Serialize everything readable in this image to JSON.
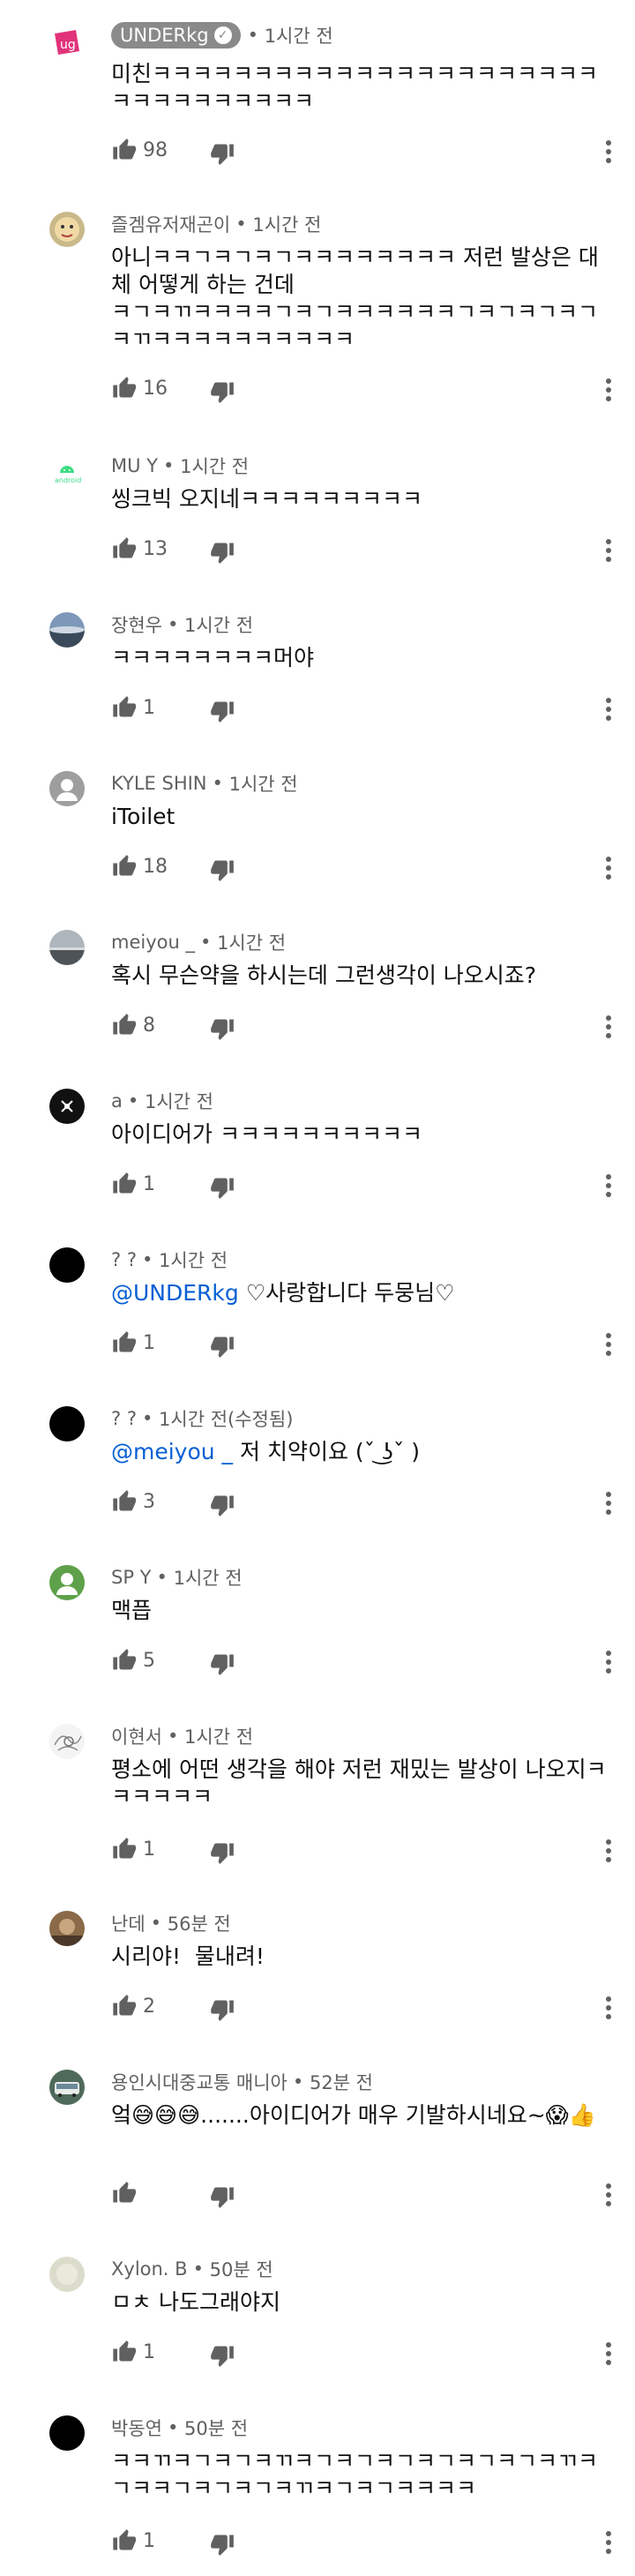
{
  "comments": [
    {
      "author": "UNDERkg",
      "time": "1시간 전",
      "text": "미친ㅋㅋㅋㅋㅋㅋㅋㅋㅋㅋㅋㅋㅋㅋㅋㅋㅋㅋㅋㅋㅋㅋㅋㅋㅋㅋㅋㅋㅋㅋㅋㅋ",
      "likes": "98",
      "is_creator": true,
      "avatar": "ug-logo"
    },
    {
      "author": "즐겜유저재곤이",
      "time": "1시간 전",
      "text": "아니ㅋㅋㄱㅋㄱㅋㄱㅋㅋㅋㅋㅋㅋㅋㅋ 저런 발상은 대체 어떻게 하는 건데\nㅋㄱㅋㄲㅋㅋㅋㅋㄱㅋㄱㅋㅋㅋㅋㅋㅋㄱㅋㄱㅋㄱㅋㄱㅋㄲㅋㅋㅋㅋㅋㅋㅋㅋㅋㅋ",
      "likes": "16",
      "avatar": "cartoon"
    },
    {
      "author": "MU Y",
      "time": "1시간 전",
      "text": "씽크빅 오지네ㅋㅋㅋㅋㅋㅋㅋㅋㅋ",
      "likes": "13",
      "avatar": "android"
    },
    {
      "author": "장현우",
      "time": "1시간 전",
      "text": "ㅋㅋㅋㅋㅋㅋㅋㅋ머야",
      "likes": "1",
      "avatar": "landscape"
    },
    {
      "author": "KYLE SHIN",
      "time": "1시간 전",
      "text": "iToilet",
      "likes": "18",
      "avatar": "default-gray"
    },
    {
      "author": "meiyou _",
      "time": "1시간 전",
      "text": "혹시 무슨약을 하시는데 그런생각이 나오시죠?",
      "likes": "8",
      "avatar": "landscape2"
    },
    {
      "author": "a",
      "time": "1시간 전",
      "text": "아이디어가 ㅋㅋㅋㅋㅋㅋㅋㅋㅋㅋ",
      "likes": "1",
      "avatar": "dark-logo"
    },
    {
      "author": "? ?",
      "time": "1시간 전",
      "mention": "@UNDERkg",
      "text": " ♡사랑합니다 두뭉님♡",
      "likes": "1",
      "avatar": "black"
    },
    {
      "author": "? ?",
      "time": "1시간 전(수정됨)",
      "mention": "@meiyou _",
      "text": " 저 치약이요 (ˇ ͜ʖˇ )",
      "likes": "3",
      "avatar": "black"
    },
    {
      "author": "SP Y",
      "time": "1시간 전",
      "text": "맥픕",
      "likes": "5",
      "avatar": "default-green"
    },
    {
      "author": "이현서",
      "time": "1시간 전",
      "text": "평소에 어떤 생각을 해야 저런 재밌는 발상이 나오지ㅋㅋㅋㅋㅋㅋ",
      "likes": "1",
      "avatar": "sketch"
    },
    {
      "author": "난데",
      "time": "56분 전",
      "text": "시리야!  물내려!",
      "likes": "2",
      "avatar": "brown"
    },
    {
      "author": "용인시대중교통 매니아",
      "time": "52분 전",
      "text": "엌😅😅😅.......아이디어가 매우 기발하시네요~😱👍",
      "likes": "",
      "avatar": "bus"
    },
    {
      "author": "Xylon. B",
      "time": "50분 전",
      "text": "ㅁㅊ 나도그래야지",
      "likes": "1",
      "avatar": "pale"
    },
    {
      "author": "박동연",
      "time": "50분 전",
      "text": "ㅋㅋㄲㅋㄱㅋㄱㅋㄲㅋㄱㅋㄱㅋㄱㅋㄱㅋㄱㅋㄱㅋㄲㅋㄱㅋㅋㄱㅋㄱㅋㄱㅋㄲㅋㄱㅋㄱㅋㅋㅋㅋ",
      "likes": "1",
      "avatar": "black"
    }
  ],
  "icons": {
    "like": "thumbs-up-icon",
    "dislike": "thumbs-down-icon",
    "more": "more-vert-icon",
    "verified": "checkmark-icon"
  },
  "separator": "•"
}
